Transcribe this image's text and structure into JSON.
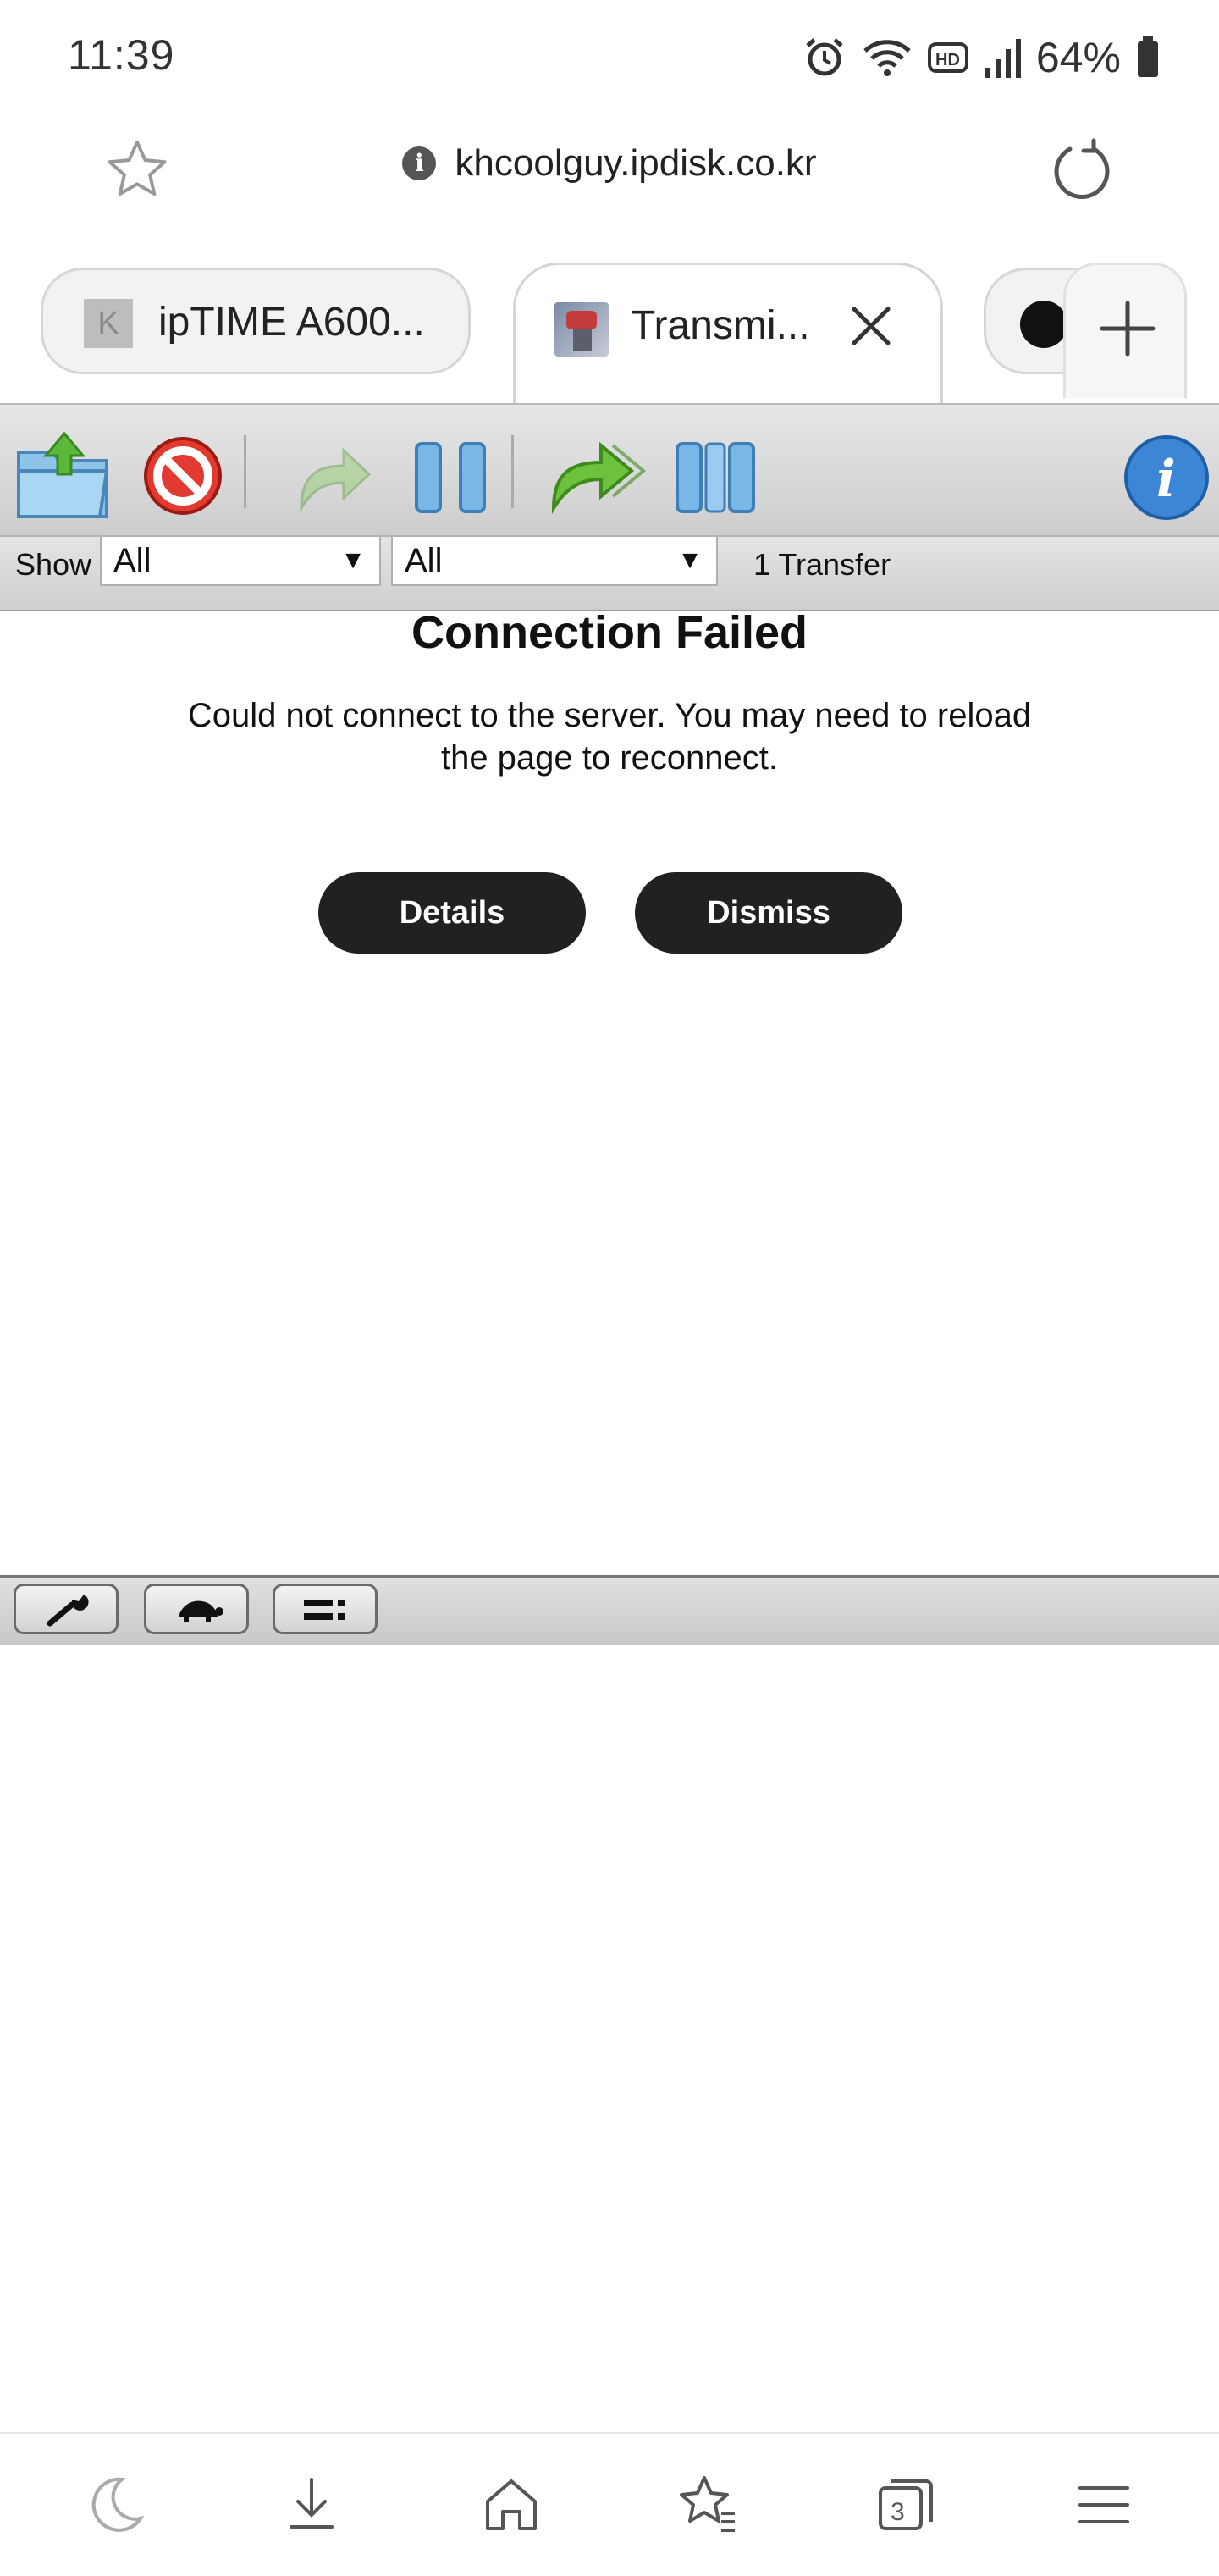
{
  "status_bar": {
    "time": "11:39",
    "battery": "64%",
    "icons": [
      "alarm-icon",
      "wifi-icon",
      "hd-voice-icon",
      "signal-icon",
      "battery-icon"
    ]
  },
  "browser": {
    "url": "khcoolguy.ipdisk.co.kr",
    "tabs": [
      {
        "label": "ipTIME A600...",
        "favicon_letter": "K"
      },
      {
        "label": "Transmi...",
        "active": true
      },
      {
        "label": ""
      }
    ],
    "tab_count": "3",
    "nav": [
      "night-mode-icon",
      "download-icon",
      "home-icon",
      "bookmarks-icon",
      "tabs-icon",
      "menu-icon"
    ]
  },
  "toolbar": {
    "buttons": [
      "open-torrent",
      "remove-torrent",
      "resume",
      "pause",
      "resume-all",
      "pause-all",
      "inspector"
    ]
  },
  "filter": {
    "show_label": "Show",
    "status_filter": "All",
    "tracker_filter": "All",
    "transfer_count": "1 Transfer"
  },
  "dialog": {
    "title": "Connection Failed",
    "message": "Could not connect to the server. You may need to reload the page to reconnect.",
    "details_label": "Details",
    "dismiss_label": "Dismiss"
  },
  "colors": {
    "dialog_button_bg": "#212121",
    "toolbar_bg": "#d6d6d6"
  }
}
